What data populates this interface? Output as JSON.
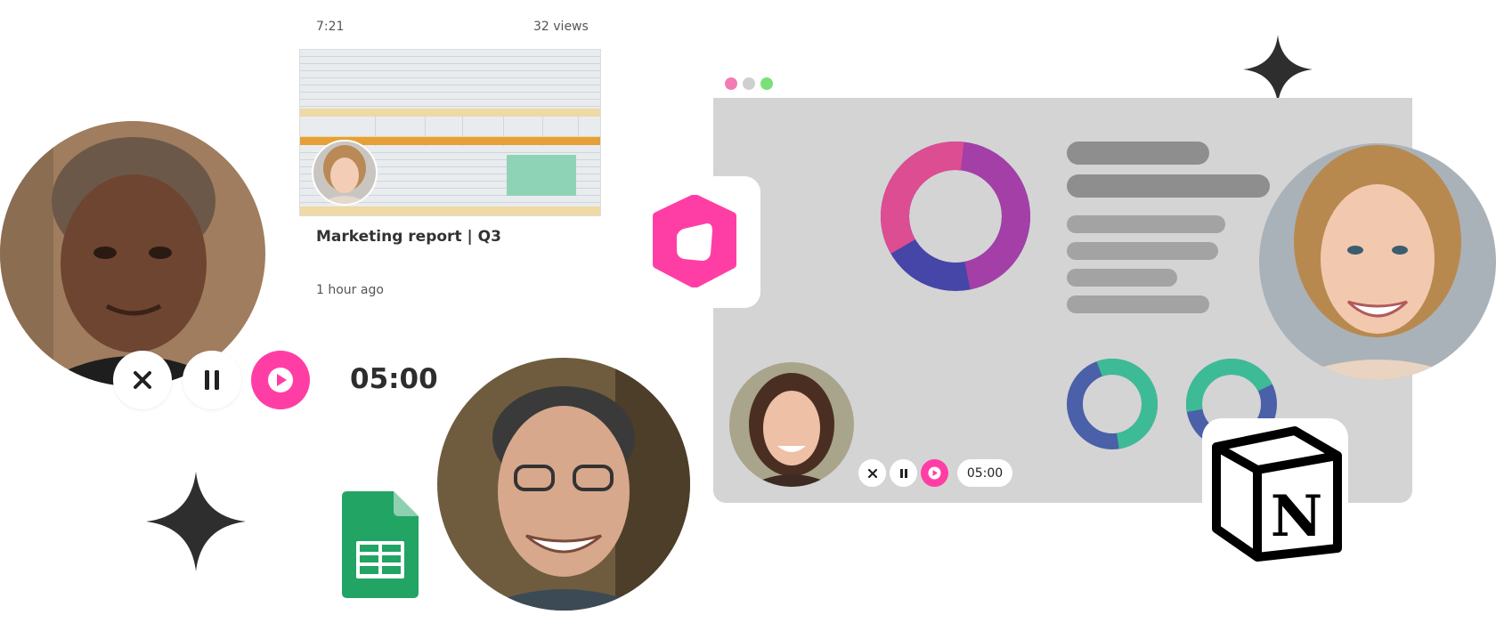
{
  "video_card": {
    "duration": "7:21",
    "views": "32 views",
    "title": "Marketing report | Q3",
    "posted": "1 hour ago"
  },
  "recorder_controls": {
    "timer": "05:00",
    "close_icon": "close-icon",
    "pause_icon": "pause-icon",
    "play_icon": "play-icon"
  },
  "app_window": {
    "mini_timer": "05:00"
  },
  "integrations": {
    "sheets_icon": "google-sheets-icon",
    "notion_letter": "N",
    "loom_icon": "app-logo-icon"
  },
  "colors": {
    "accent_pink": "#ff3ea5",
    "donut_pink": "#dd4d92",
    "donut_purple": "#a43fa8",
    "donut_blue": "#4646a8",
    "ring_green": "#3dbb96",
    "ring_blue": "#4a60a8",
    "window_gray": "#d4d4d4",
    "bar_gray": "#8e8e8e"
  }
}
